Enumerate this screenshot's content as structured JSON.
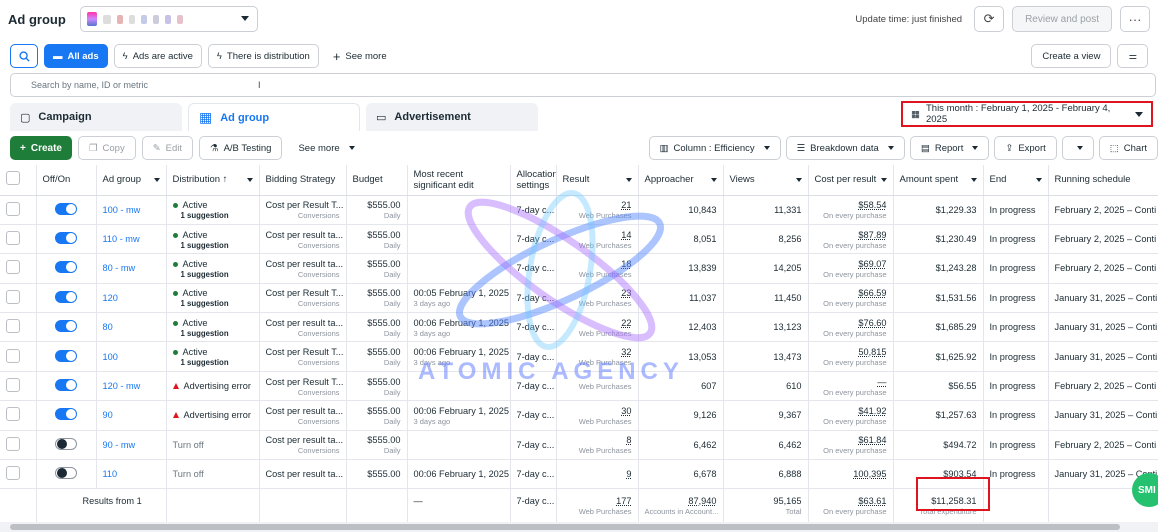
{
  "header": {
    "title": "Ad group",
    "update_text": "Update time: just finished",
    "review_post_label": "Review and post",
    "more_label": "···"
  },
  "filters": {
    "chips": [
      "All ads",
      "Ads are active",
      "There is distribution"
    ],
    "see_more": "See more",
    "create_view": "Create a view",
    "search_placeholder": "Search by name, ID or metric"
  },
  "tabs": [
    "Campaign",
    "Ad group",
    "Advertisement"
  ],
  "date_range": "This month : February 1, 2025 - February 4, 2025",
  "toolbar": {
    "create": "Create",
    "copy": "Copy",
    "edit": "Edit",
    "ab_testing": "A/B Testing",
    "see_more": "See more",
    "column": "Column : Efficiency",
    "breakdown": "Breakdown data",
    "report": "Report",
    "export": "Export",
    "chart": "Chart"
  },
  "columns": [
    "Off/On",
    "Ad group",
    "Distribution ↑",
    "Bidding Strategy",
    "Budget",
    "Most recent significant edit",
    "Allocation settings",
    "Result",
    "Approacher",
    "Views",
    "Cost per result",
    "Amount spent",
    "End",
    "Running schedule"
  ],
  "rows": [
    {
      "on": true,
      "name": "100 - mw",
      "dist": "Active",
      "sugg": "1 suggestion",
      "bid": "Cost per Result T...",
      "bid_sub": "Conversions",
      "budget": "$555.00",
      "budget_sub": "Daily",
      "edit": "",
      "edit_sub": "",
      "alloc": "7-day c...",
      "result": "21",
      "result_sub": "Web Purchases",
      "approacher": "10,843",
      "views": "11,331",
      "cpr": "$58.54",
      "cpr_sub": "On every purchase",
      "spent": "$1,229.33",
      "end": "In progress",
      "schedule": "February 2, 2025 – Conti"
    },
    {
      "on": true,
      "name": "110 - mw",
      "dist": "Active",
      "sugg": "1 suggestion",
      "bid": "Cost per result ta...",
      "bid_sub": "Conversions",
      "budget": "$555.00",
      "budget_sub": "Daily",
      "edit": "",
      "edit_sub": "",
      "alloc": "7-day c...",
      "result": "14",
      "result_sub": "Web Purchases",
      "approacher": "8,051",
      "views": "8,256",
      "cpr": "$87.89",
      "cpr_sub": "On every purchase",
      "spent": "$1,230.49",
      "end": "In progress",
      "schedule": "February 2, 2025 – Conti"
    },
    {
      "on": true,
      "name": "80 - mw",
      "dist": "Active",
      "sugg": "1 suggestion",
      "bid": "Cost per result ta...",
      "bid_sub": "Conversions",
      "budget": "$555.00",
      "budget_sub": "Daily",
      "edit": "",
      "edit_sub": "",
      "alloc": "7-day c...",
      "result": "18",
      "result_sub": "Web Purchases",
      "approacher": "13,839",
      "views": "14,205",
      "cpr": "$69.07",
      "cpr_sub": "On every purchase",
      "spent": "$1,243.28",
      "end": "In progress",
      "schedule": "February 2, 2025 – Conti"
    },
    {
      "on": true,
      "name": "120",
      "dist": "Active",
      "sugg": "1 suggestion",
      "bid": "Cost per Result T...",
      "bid_sub": "Conversions",
      "budget": "$555.00",
      "budget_sub": "Daily",
      "edit": "00:05 February 1, 2025",
      "edit_sub": "3 days ago",
      "alloc": "7-day c...",
      "result": "23",
      "result_sub": "Web Purchases",
      "approacher": "11,037",
      "views": "11,450",
      "cpr": "$66.59",
      "cpr_sub": "On every purchase",
      "spent": "$1,531.56",
      "end": "In progress",
      "schedule": "January 31, 2025 – Conti"
    },
    {
      "on": true,
      "name": "80",
      "dist": "Active",
      "sugg": "1 suggestion",
      "bid": "Cost per result ta...",
      "bid_sub": "Conversions",
      "budget": "$555.00",
      "budget_sub": "Daily",
      "edit": "00:06 February 1, 2025",
      "edit_sub": "3 days ago",
      "alloc": "7-day c...",
      "result": "22",
      "result_sub": "Web Purchases",
      "approacher": "12,403",
      "views": "13,123",
      "cpr": "$76.60",
      "cpr_sub": "On every purchase",
      "spent": "$1,685.29",
      "end": "In progress",
      "schedule": "January 31, 2025 – Conti"
    },
    {
      "on": true,
      "name": "100",
      "dist": "Active",
      "sugg": "1 suggestion",
      "bid": "Cost per Result T...",
      "bid_sub": "Conversions",
      "budget": "$555.00",
      "budget_sub": "Daily",
      "edit": "00:06 February 1, 2025",
      "edit_sub": "3 days ago",
      "alloc": "7-day c...",
      "result": "32",
      "result_sub": "Web Purchases",
      "approacher": "13,053",
      "views": "13,473",
      "cpr": "50,815",
      "cpr_sub": "On every purchase",
      "spent": "$1,625.92",
      "end": "In progress",
      "schedule": "January 31, 2025 – Conti"
    },
    {
      "on": true,
      "name": "120 - mw",
      "dist": "Advertising error",
      "err": true,
      "sugg": "",
      "bid": "Cost per Result T...",
      "bid_sub": "Conversions",
      "budget": "$555.00",
      "budget_sub": "Daily",
      "edit": "",
      "edit_sub": "",
      "alloc": "7-day c...",
      "result": "",
      "result_sub": "Web Purchases",
      "approacher": "607",
      "views": "610",
      "cpr": "—",
      "cpr_sub": "On every purchase",
      "spent": "$56.55",
      "end": "In progress",
      "schedule": "February 2, 2025 – Conti"
    },
    {
      "on": true,
      "name": "90",
      "dist": "Advertising error",
      "err": true,
      "sugg": "",
      "bid": "Cost per result ta...",
      "bid_sub": "Conversions",
      "budget": "$555.00",
      "budget_sub": "Daily",
      "edit": "00:06 February 1, 2025",
      "edit_sub": "3 days ago",
      "alloc": "7-day c...",
      "result": "30",
      "result_sub": "Web Purchases",
      "approacher": "9,126",
      "views": "9,367",
      "cpr": "$41.92",
      "cpr_sub": "On every purchase",
      "spent": "$1,257.63",
      "end": "In progress",
      "schedule": "January 31, 2025 – Conti"
    },
    {
      "on": false,
      "name": "90 - mw",
      "dist": "Turn off",
      "off": true,
      "sugg": "",
      "bid": "Cost per result ta...",
      "bid_sub": "Conversions",
      "budget": "$555.00",
      "budget_sub": "Daily",
      "edit": "",
      "edit_sub": "",
      "alloc": "7-day c...",
      "result": "8",
      "result_sub": "Web Purchases",
      "approacher": "6,462",
      "views": "6,462",
      "cpr": "$61.84",
      "cpr_sub": "On every purchase",
      "spent": "$494.72",
      "end": "In progress",
      "schedule": "February 2, 2025 – Conti"
    },
    {
      "on": false,
      "name": "110",
      "dist": "Turn off",
      "off": true,
      "sugg": "",
      "bid": "Cost per result ta...",
      "bid_sub": "",
      "budget": "$555.00",
      "budget_sub": "",
      "edit": "00:06 February 1, 2025",
      "edit_sub": "",
      "alloc": "7-day c...",
      "result": "9",
      "result_sub": "",
      "approacher": "6,678",
      "views": "6,888",
      "cpr": "100,395",
      "cpr_sub": "",
      "spent": "$903.54",
      "end": "In progress",
      "schedule": "January 31, 2025 – Conti"
    }
  ],
  "summary": {
    "label": "Results from 1",
    "edit": "—",
    "alloc": "7-day c...",
    "result": "177",
    "result_sub": "Web Purchases",
    "approacher": "87,940",
    "approacher_sub": "Accounts in Account...",
    "views": "95,165",
    "views_sub": "Total",
    "cpr": "$63.61",
    "cpr_sub": "On every purchase",
    "spent": "$11,258.31",
    "spent_sub": "Total expenditure"
  },
  "watermark": "ATOMIC AGENCY",
  "chat_label": "SMI",
  "colors": {
    "accent": "#1877f2",
    "create": "#1e7d38",
    "highlight": "#e0141e"
  }
}
